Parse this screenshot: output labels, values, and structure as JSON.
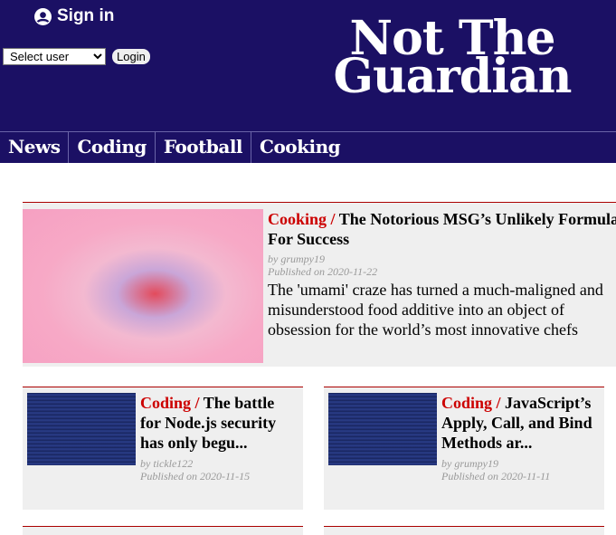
{
  "header": {
    "signin_label": "Sign in",
    "user_select": "Select user",
    "login_label": "Login",
    "logo": "Not The Guardian"
  },
  "nav": [
    "News",
    "Coding",
    "Football",
    "Cooking"
  ],
  "featured": {
    "category": "Cooking",
    "separator": " / ",
    "title": "The Notorious MSG’s Unlikely Formula For Success",
    "author": "by grumpy19",
    "published": "Published on 2020-11-22",
    "description": "The 'umami' craze has turned a much-maligned and misunderstood food additive into an object of obsession for the world’s most innovative chefs"
  },
  "articles": [
    {
      "category": "Coding",
      "separator": " / ",
      "title": "The battle for Node.js security has only begu...",
      "author": "by tickle122",
      "published": "Published on 2020-11-15"
    },
    {
      "category": "Coding",
      "separator": " / ",
      "title": "JavaScript’s Apply, Call, and Bind Methods ar...",
      "author": "by grumpy19",
      "published": "Published on 2020-11-11"
    }
  ],
  "colors": {
    "header": "#1b1064",
    "category": "#cc0000"
  }
}
